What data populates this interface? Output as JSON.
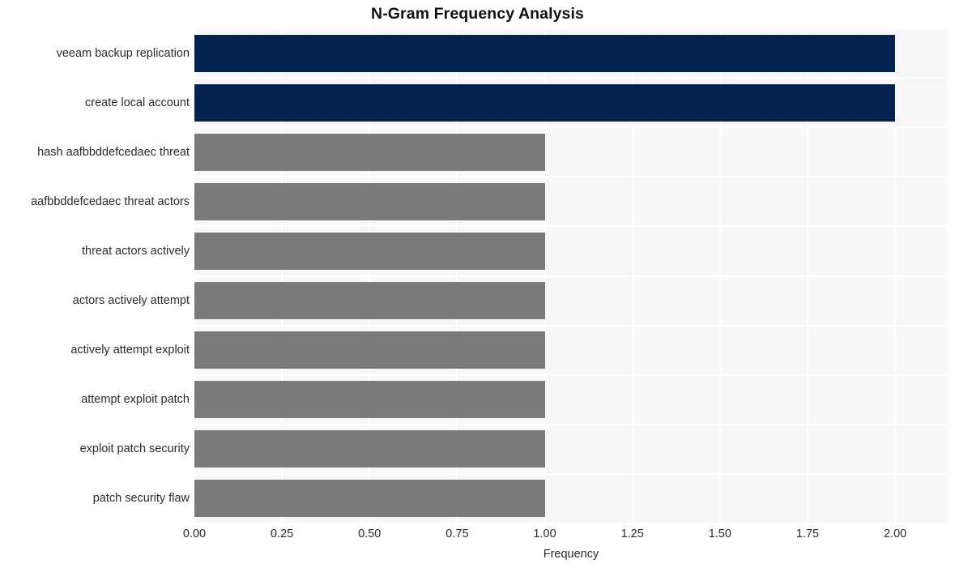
{
  "chart_data": {
    "type": "bar",
    "orientation": "horizontal",
    "title": "N-Gram Frequency Analysis",
    "xlabel": "Frequency",
    "ylabel": "",
    "categories": [
      "veeam backup replication",
      "create local account",
      "hash aafbbddefcedaec threat",
      "aafbbddefcedaec threat actors",
      "threat actors actively",
      "actors actively attempt",
      "actively attempt exploit",
      "attempt exploit patch",
      "exploit patch security",
      "patch security flaw"
    ],
    "values": [
      2,
      2,
      1,
      1,
      1,
      1,
      1,
      1,
      1,
      1
    ],
    "bar_colors": [
      "#04234f",
      "#04234f",
      "#7b7b79",
      "#7b7b79",
      "#7b7b79",
      "#7b7b79",
      "#7b7b79",
      "#7b7b79",
      "#7b7b79",
      "#7b7b79"
    ],
    "xlim": [
      0,
      2.15
    ],
    "xticks": [
      0,
      0.25,
      0.5,
      0.75,
      1,
      1.25,
      1.5,
      1.75,
      2
    ],
    "xticklabels": [
      "0.00",
      "0.25",
      "0.50",
      "0.75",
      "1.00",
      "1.25",
      "1.50",
      "1.75",
      "2.00"
    ],
    "grid": true,
    "grid_color": "#ffffff",
    "plot_background": "#f7f7f9",
    "figure_background": "#ffffff",
    "legend": null
  },
  "colors": {
    "accent_primary": "#04234f",
    "accent_secondary": "#7b7b79",
    "plot_bg": "#f7f7f9",
    "grid": "#ffffff",
    "text": "#2b2b2b",
    "title": "#111111"
  }
}
